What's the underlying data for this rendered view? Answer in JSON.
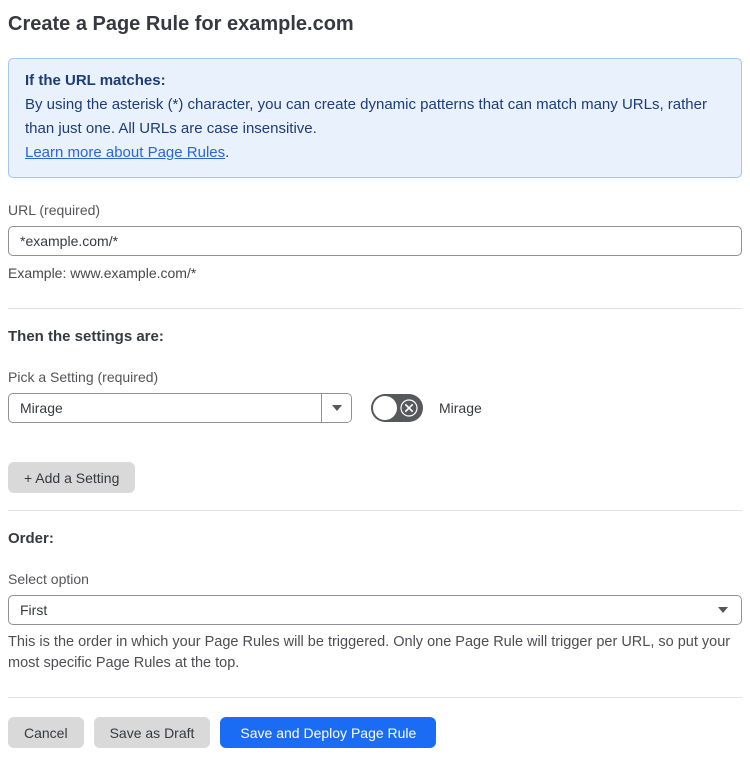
{
  "page": {
    "title": "Create a Page Rule for example.com"
  },
  "info_box": {
    "heading": "If the URL matches:",
    "body": "By using the asterisk (*) character, you can create dynamic patterns that can match many URLs, rather than just one. All URLs are case insensitive.",
    "link_label": "Learn more about Page Rules",
    "link_suffix": "."
  },
  "url_field": {
    "label": "URL (required)",
    "value": "*example.com/*",
    "helper": "Example: www.example.com/*"
  },
  "settings_section": {
    "heading": "Then the settings are:",
    "picker_label": "Pick a Setting (required)",
    "picker_value": "Mirage",
    "toggle_label": "Mirage",
    "toggle_state": "off",
    "add_button_label": "+ Add a Setting"
  },
  "order_section": {
    "heading": "Order:",
    "label": "Select option",
    "value": "First",
    "helper": "This is the order in which your Page Rules will be triggered. Only one Page Rule will trigger per URL, so put your most specific Page Rules at the top."
  },
  "footer": {
    "cancel_label": "Cancel",
    "save_draft_label": "Save as Draft",
    "save_deploy_label": "Save and Deploy Page Rule"
  },
  "colors": {
    "accent_blue": "#1a6cf5",
    "info_background": "#e8f1fc",
    "info_border": "#a3c7ed",
    "info_text": "#1d3d78",
    "link_blue": "#2e63da",
    "toggle_off": "#56585c",
    "button_gray": "#d9d9d9",
    "text_dark": "#36393f",
    "label_gray": "#54555a"
  }
}
